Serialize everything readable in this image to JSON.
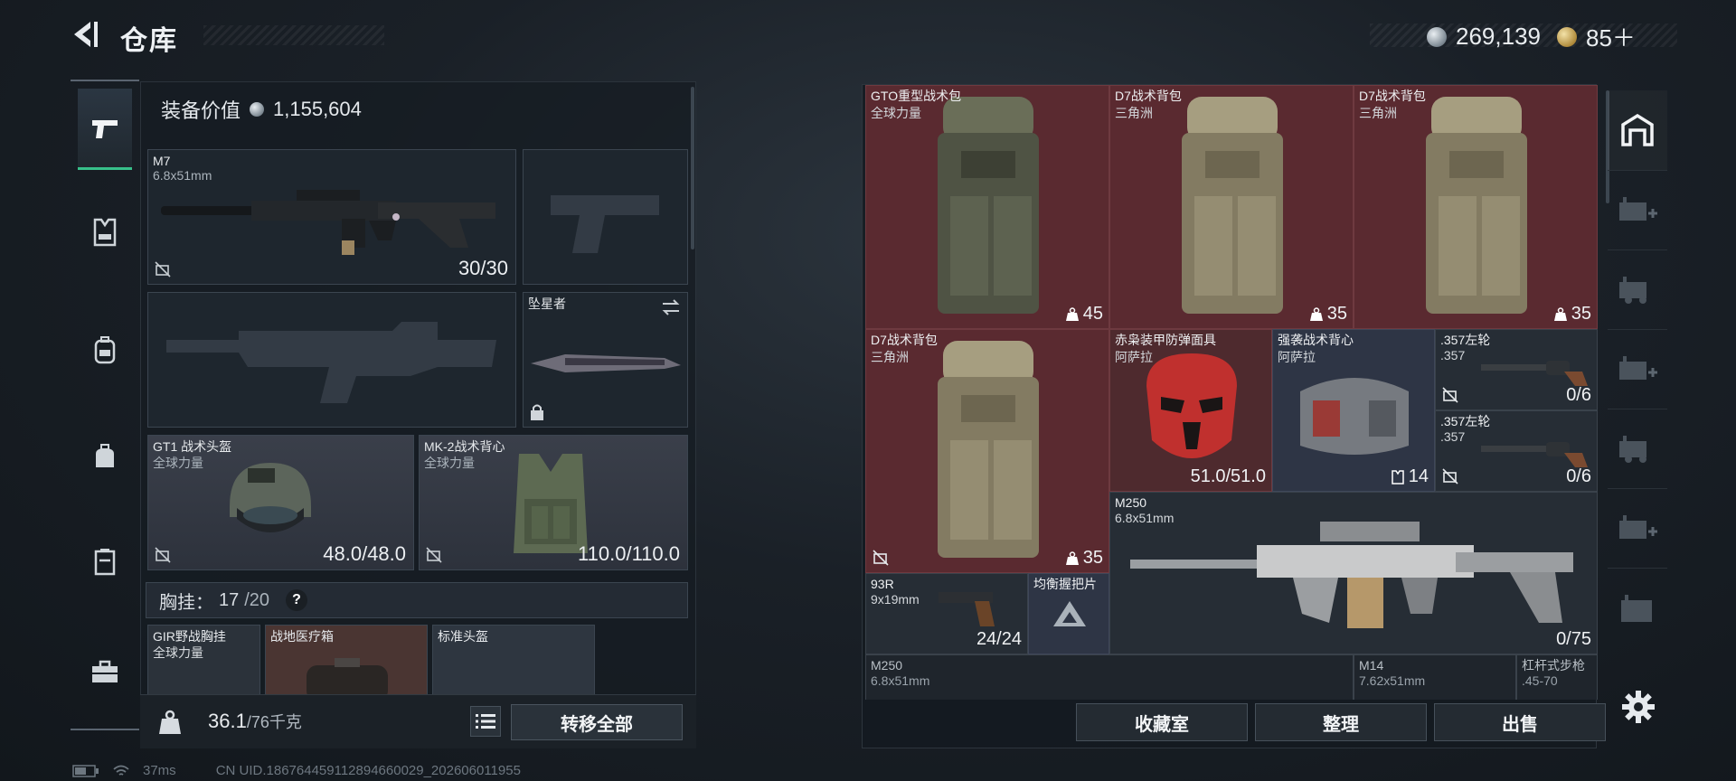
{
  "header": {
    "title": "仓库",
    "silver": "269,139",
    "gold": "85＋"
  },
  "left": {
    "equip_value_label": "装备价值",
    "equip_value": "1,155,604",
    "primary": {
      "name": "M7",
      "caliber": "6.8x51mm",
      "ammo": "30/30"
    },
    "melee": {
      "name": "坠星者"
    },
    "helmet": {
      "name": "GT1 战术头盔",
      "faction": "全球力量",
      "durability": "48.0/48.0"
    },
    "armor": {
      "name": "MK-2战术背心",
      "faction": "全球力量",
      "durability": "110.0/110.0"
    },
    "chest_rig": {
      "label": "胸挂：",
      "used": "17",
      "total": "/20",
      "help": "?"
    },
    "pouch_items": [
      {
        "name": "GIR野战胸挂",
        "faction": "全球力量"
      },
      {
        "name": "战地医疗箱",
        "faction": ""
      },
      {
        "name": "标准头盔",
        "faction": ""
      }
    ],
    "weight_value": "36.1",
    "weight_max": "/76千克",
    "transfer_all": "转移全部",
    "status": {
      "ping": "37ms",
      "uid": "CN UID.18676445911289466002​9_202606011955"
    }
  },
  "storage": {
    "items": [
      {
        "name": "GTO重型战术包",
        "faction": "全球力量",
        "value": "45"
      },
      {
        "name": "D7战术背包",
        "faction": "三角洲",
        "value": "35"
      },
      {
        "name": "D7战术背包",
        "faction": "三角洲",
        "value": "35"
      },
      {
        "name": "D7战术背包",
        "faction": "三角洲",
        "value": "35"
      },
      {
        "name": "赤枭装甲防弹面具",
        "faction": "阿萨拉",
        "value": "51.0/51.0"
      },
      {
        "name": "强袭战术背心",
        "faction": "阿萨拉",
        "value": "14"
      },
      {
        "name": ".357左轮",
        "faction": ".357",
        "value": "0/6"
      },
      {
        "name": ".357左轮",
        "faction": ".357",
        "value": "0/6"
      },
      {
        "name": "M250",
        "faction": "6.8x51mm",
        "value": "0/75"
      },
      {
        "name": "93R",
        "faction": "9x19mm",
        "value": "24/24"
      },
      {
        "name": "均衡握把片",
        "faction": "",
        "value": ""
      },
      {
        "name": "M250",
        "faction": "6.8x51mm",
        "value": ""
      },
      {
        "name": "M14",
        "faction": "7.62x51mm",
        "value": ""
      },
      {
        "name": "杠杆式步枪",
        "faction": ".45-70",
        "value": ""
      }
    ],
    "buttons": {
      "collection": "收藏室",
      "sort": "整理",
      "sell": "出售"
    }
  },
  "icons": {
    "back": "back-arrow-icon",
    "categories": [
      "pistol-icon",
      "vest-icon",
      "backpack-icon",
      "bag-icon",
      "case-icon",
      "toolbox-icon"
    ],
    "side_tabs": [
      "warehouse-icon",
      "add-storage-icon",
      "truck-icon",
      "add-storage-icon",
      "truck-icon",
      "add-storage-icon",
      "folder-icon"
    ],
    "settings": "gear-icon"
  },
  "colors": {
    "accent": "#37c08a",
    "red_item": "#5a2a30",
    "blue_item": "#2e3545"
  }
}
